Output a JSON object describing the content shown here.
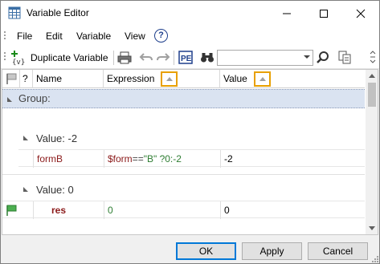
{
  "window": {
    "title": "Variable Editor",
    "colors": {
      "accent": "#0078d7",
      "sort_highlight": "#e8a000",
      "group_bg": "#dae3f1",
      "name_color": "#8b1a1a",
      "expr_var": "#8b1a1a",
      "expr_string": "#2e7d32",
      "expr_number": "#2e7d32"
    }
  },
  "menu": {
    "items": [
      "File",
      "Edit",
      "Variable",
      "View"
    ],
    "help_icon": "help-circle-icon"
  },
  "toolbar": {
    "duplicate_label": "Duplicate Variable",
    "icons": [
      "new-variable-icon",
      "print-icon",
      "undo-icon",
      "redo-icon",
      "property-editor-icon",
      "binoculars-find-icon",
      "search-go-icon",
      "copy-icon"
    ],
    "search_value": ""
  },
  "grid": {
    "columns": [
      {
        "label": "?"
      },
      {
        "label": "Name"
      },
      {
        "label": "Expression",
        "sort": "ascending"
      },
      {
        "label": "Value",
        "sort": "ascending"
      }
    ],
    "group_label": "Group:",
    "subgroups": [
      {
        "label": "Value: -2",
        "rows": [
          {
            "flag": false,
            "name": "formB",
            "expression": {
              "var": "$form",
              "op": "==",
              "str": "\"B\"",
              "rest": " ?0:-2"
            },
            "value": "-2",
            "bold": false
          }
        ]
      },
      {
        "label": "Value: 0",
        "rows": [
          {
            "flag": true,
            "name": "res",
            "expression": {
              "var": "",
              "op": "",
              "str": "",
              "rest": "0"
            },
            "value": "0",
            "bold": true
          }
        ]
      }
    ]
  },
  "buttons": {
    "ok": "OK",
    "apply": "Apply",
    "cancel": "Cancel"
  }
}
